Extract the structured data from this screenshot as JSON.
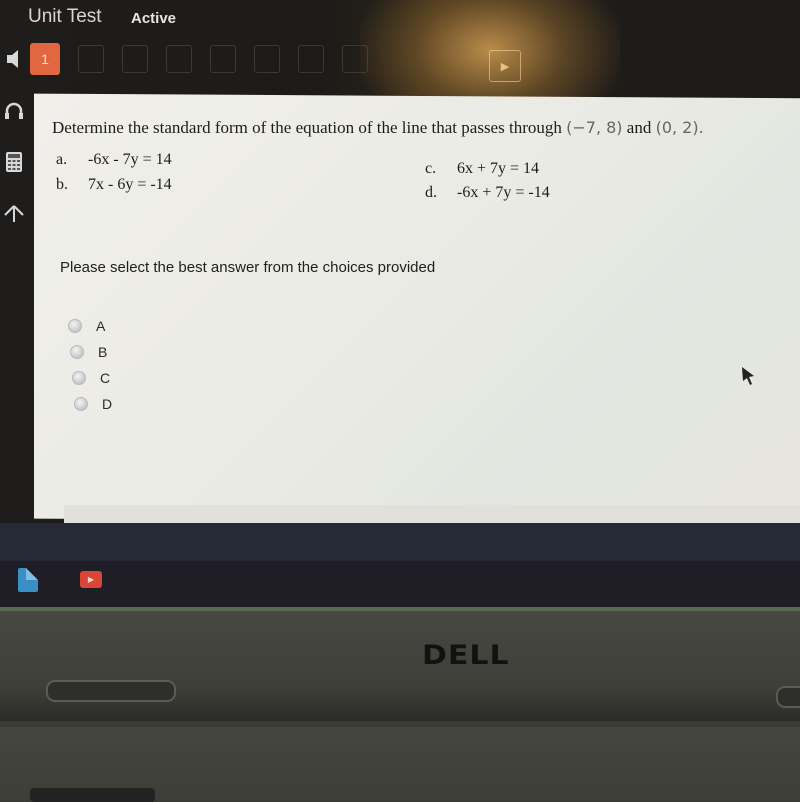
{
  "header": {
    "title": "Unit Test",
    "status": "Active"
  },
  "question_nav": {
    "current": "1",
    "next_icon": "▶"
  },
  "sidebar": {
    "icons": [
      "speaker-icon",
      "headphones-icon",
      "calculator-icon",
      "up-arrow-icon"
    ]
  },
  "question": {
    "text": "Determine the standard form of the equation of the line that passes through",
    "point1": "(−7, 8)",
    "connector": "and",
    "point2": "(0, 2)",
    "end": ".",
    "options": [
      {
        "letter": "a.",
        "equation": "-6x - 7y = 14"
      },
      {
        "letter": "b.",
        "equation": "7x - 6y = -14"
      },
      {
        "letter": "c.",
        "equation": "6x + 7y = 14"
      },
      {
        "letter": "d.",
        "equation": "-6x + 7y = -14"
      }
    ]
  },
  "prompt": "Please select the best answer from the choices provided",
  "choices": [
    {
      "label": "A",
      "selected": false
    },
    {
      "label": "B",
      "selected": false
    },
    {
      "label": "C",
      "selected": false
    },
    {
      "label": "D",
      "selected": false
    }
  ],
  "taskbar": {
    "apps": [
      "docs-icon",
      "youtube-icon"
    ],
    "youtube_glyph": "▶"
  },
  "laptop": {
    "brand": "DELL"
  }
}
